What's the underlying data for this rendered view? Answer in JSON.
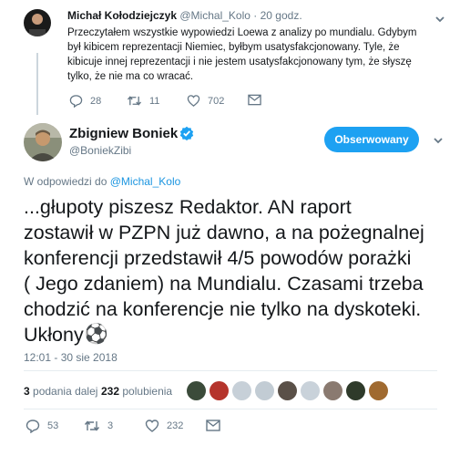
{
  "reply_tweet": {
    "author_name": "Michał Kołodziejczyk",
    "handle": "@Michal_Kolo",
    "separator": "·",
    "time": "20 godz.",
    "text": "Przeczytałem wszystkie wypowiedzi Loewa z analizy po mundialu. Gdybym był kibicem reprezentacji Niemiec, byłbym usatysfakcjonowany. Tyle, że kibicuje innej reprezentacji i nie jestem usatysfakcjonowany tym, że słyszę tylko, że nie ma co wracać.",
    "replies": "28",
    "retweets": "11",
    "likes": "702"
  },
  "main_tweet": {
    "author_name": "Zbigniew Boniek",
    "handle": "@BoniekZibi",
    "follow_label": "Obserwowany",
    "in_reply_prefix": "W odpowiedzi do",
    "in_reply_handle": "@Michal_Kolo",
    "text_lines": [
      "...głupoty piszesz Redaktor. AN raport",
      "zostawił w PZPN już dawno, a na pożegnalnej",
      "konferencji przedstawił 4/5 powodów porażki",
      "( Jego zdaniem) na Mundialu. Czasami trzeba",
      "chodzić na konferencje nie tylko na dyskoteki.",
      "Ukłony"
    ],
    "emoji": "⚽",
    "timestamp": "12:01 - 30 sie 2018",
    "retweets_count": "3",
    "retweets_label": "podania dalej",
    "likes_count": "232",
    "likes_label": "polubienia",
    "replies": "53",
    "retweets": "3",
    "likes": "232"
  },
  "colors": {
    "accent": "#1da1f2",
    "muted": "#657786",
    "verified": "#1da1f2"
  }
}
